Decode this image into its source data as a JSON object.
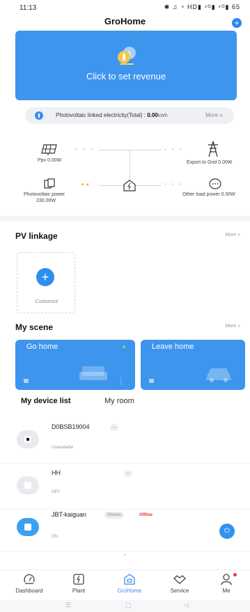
{
  "status_bar": {
    "time": "11:13",
    "icons_text": "✱ ♫ ◔ HD▮ ⁴ᴳ▮ ⁴ᴳ▮ 65"
  },
  "header": {
    "title": "GroHome",
    "add_icon": "plus-icon"
  },
  "revenue_card": {
    "text": "Click to set revenue",
    "icon": "coins-icon",
    "color": "#3d95ee"
  },
  "pv_total": {
    "label": "Photovoltaic linked electricity(Total) :",
    "value": "0.00",
    "unit": "kWh",
    "more": "More",
    "more_chevron": "»"
  },
  "energy_flow": {
    "ppv": "Ppv 0.00W",
    "export": "Export to Grid 0.00W",
    "photovoltaic_label": "Photovoltaic power",
    "photovoltaic_value": "230.00W",
    "other_load": "Other load power 0.00W"
  },
  "pv_linkage": {
    "title": "PV linkage",
    "more": "More",
    "more_chevron": "»",
    "customize_label": "Customize"
  },
  "my_scene": {
    "title": "My scene",
    "more": "More",
    "more_chevron": "»",
    "scenes": [
      {
        "name": "Go home"
      },
      {
        "name": "Leave home"
      }
    ]
  },
  "device_tabs": {
    "active": "My device list",
    "inactive": "My room"
  },
  "devices": [
    {
      "name": "D0BSB19004",
      "tag": "--",
      "state": "Unavailable"
    },
    {
      "name": "HH",
      "tag": "--",
      "state": "OFF"
    },
    {
      "name": "JBT-kaiguan",
      "room": "Kitchen",
      "status": "Offline",
      "state": "ON"
    }
  ],
  "collapse_icon": "chevron-down-icon",
  "nav": {
    "items": [
      {
        "label": "Dashboard",
        "icon": "dashboard-icon"
      },
      {
        "label": "Plant",
        "icon": "plant-icon"
      },
      {
        "label": "GroHome",
        "icon": "home-icon"
      },
      {
        "label": "Service",
        "icon": "service-icon"
      },
      {
        "label": "Me",
        "icon": "user-icon"
      }
    ],
    "active_color": "#3a8ef0"
  }
}
